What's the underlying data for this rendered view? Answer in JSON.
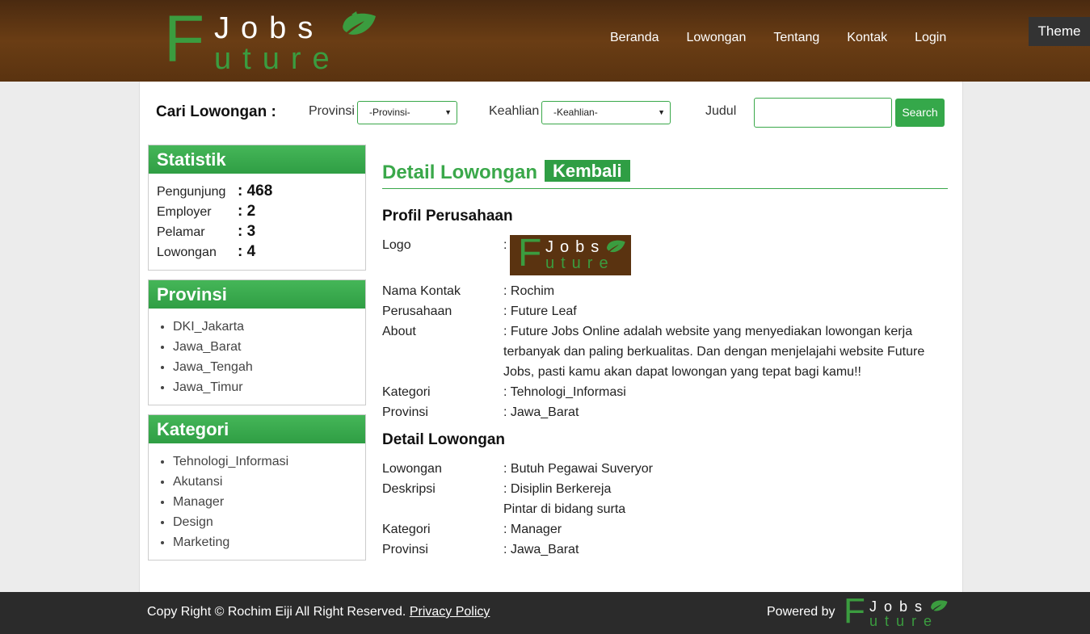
{
  "header": {
    "logo": {
      "big_letter": "F",
      "top_text": "Jobs",
      "bottom_text": "uture"
    },
    "nav": [
      "Beranda",
      "Lowongan",
      "Tentang",
      "Kontak",
      "Login"
    ],
    "theme_label": "Theme"
  },
  "search": {
    "title": "Cari Lowongan :",
    "provinsi_label": "Provinsi",
    "provinsi_value": "-Provinsi-",
    "keahlian_label": "Keahlian",
    "keahlian_value": "-Keahlian-",
    "judul_label": "Judul",
    "judul_value": "",
    "button_label": "Search"
  },
  "sidebar": {
    "statistik": {
      "title": "Statistik",
      "rows": [
        {
          "label": "Pengunjung",
          "value": ": 468"
        },
        {
          "label": "Employer",
          "value": ": 2"
        },
        {
          "label": "Pelamar",
          "value": ": 3"
        },
        {
          "label": "Lowongan",
          "value": ": 4"
        }
      ]
    },
    "provinsi": {
      "title": "Provinsi",
      "items": [
        "DKI_Jakarta",
        "Jawa_Barat",
        "Jawa_Tengah",
        "Jawa_Timur"
      ]
    },
    "kategori": {
      "title": "Kategori",
      "items": [
        "Tehnologi_Informasi",
        "Akutansi",
        "Manager",
        "Design",
        "Marketing"
      ]
    }
  },
  "main": {
    "title": "Detail Lowongan",
    "back_label": "Kembali",
    "profil": {
      "heading": "Profil Perusahaan",
      "logo_label": "Logo",
      "logo_colon": ":",
      "nama_kontak_label": "Nama Kontak",
      "nama_kontak": ": Rochim",
      "perusahaan_label": "Perusahaan",
      "perusahaan": ": Future Leaf",
      "about_label": "About",
      "about": ": Future Jobs Online adalah website yang menyediakan lowongan kerja terbanyak dan paling berkualitas. Dan dengan menjelajahi website Future Jobs, pasti kamu akan dapat lowongan yang tepat bagi kamu!!",
      "kategori_label": "Kategori",
      "kategori": ": Tehnologi_Informasi",
      "provinsi_label": "Provinsi",
      "provinsi": ": Jawa_Barat"
    },
    "detail": {
      "heading": "Detail Lowongan",
      "lowongan_label": "Lowongan",
      "lowongan": ": Butuh Pegawai Suveryor",
      "deskripsi_label": "Deskripsi",
      "deskripsi_line1": ": Disiplin Berkereja",
      "deskripsi_line2": "Pintar di bidang surta",
      "kategori_label": "Kategori",
      "kategori": ": Manager",
      "provinsi_label": "Provinsi",
      "provinsi": ": Jawa_Barat"
    }
  },
  "footer": {
    "copyright": "Copy Right © Rochim Eiji All Right Reserved.",
    "privacy_label": "Privacy Policy",
    "powered_label": "Powered by"
  },
  "colors": {
    "header_brown": "#5a3310",
    "accent_green": "#3aa84a",
    "footer_dark": "#2b2b2b"
  }
}
